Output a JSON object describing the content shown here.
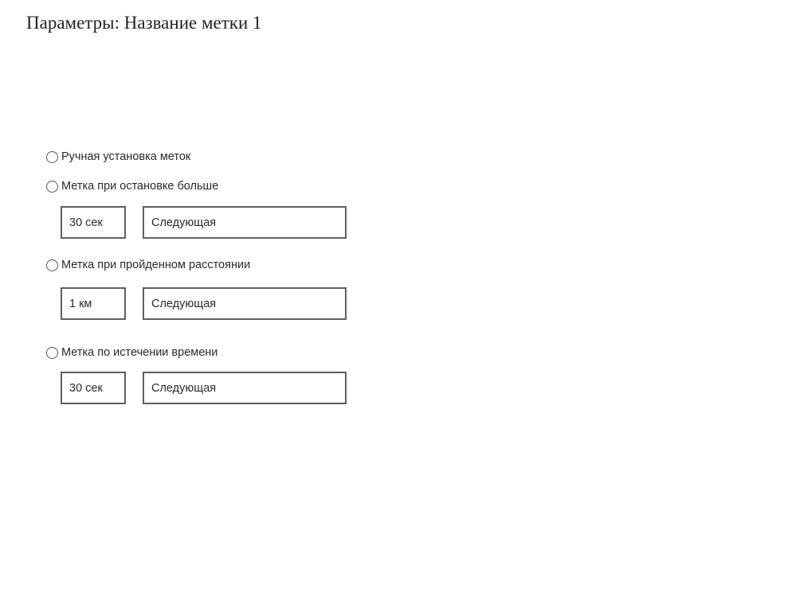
{
  "page": {
    "title": "Параметры: Название метки 1"
  },
  "options": [
    {
      "label": "Ручная установка меток",
      "selected": false
    },
    {
      "label": "Метка при остановке больше",
      "selected": false,
      "value": "30 сек",
      "mode": "Следующая"
    },
    {
      "label": "Метка при пройденном расстоянии",
      "selected": false,
      "value": "1 км",
      "mode": "Следующая"
    },
    {
      "label": "Метка по истечении времени",
      "selected": false,
      "value": "30 сек",
      "mode": "Следующая"
    }
  ]
}
